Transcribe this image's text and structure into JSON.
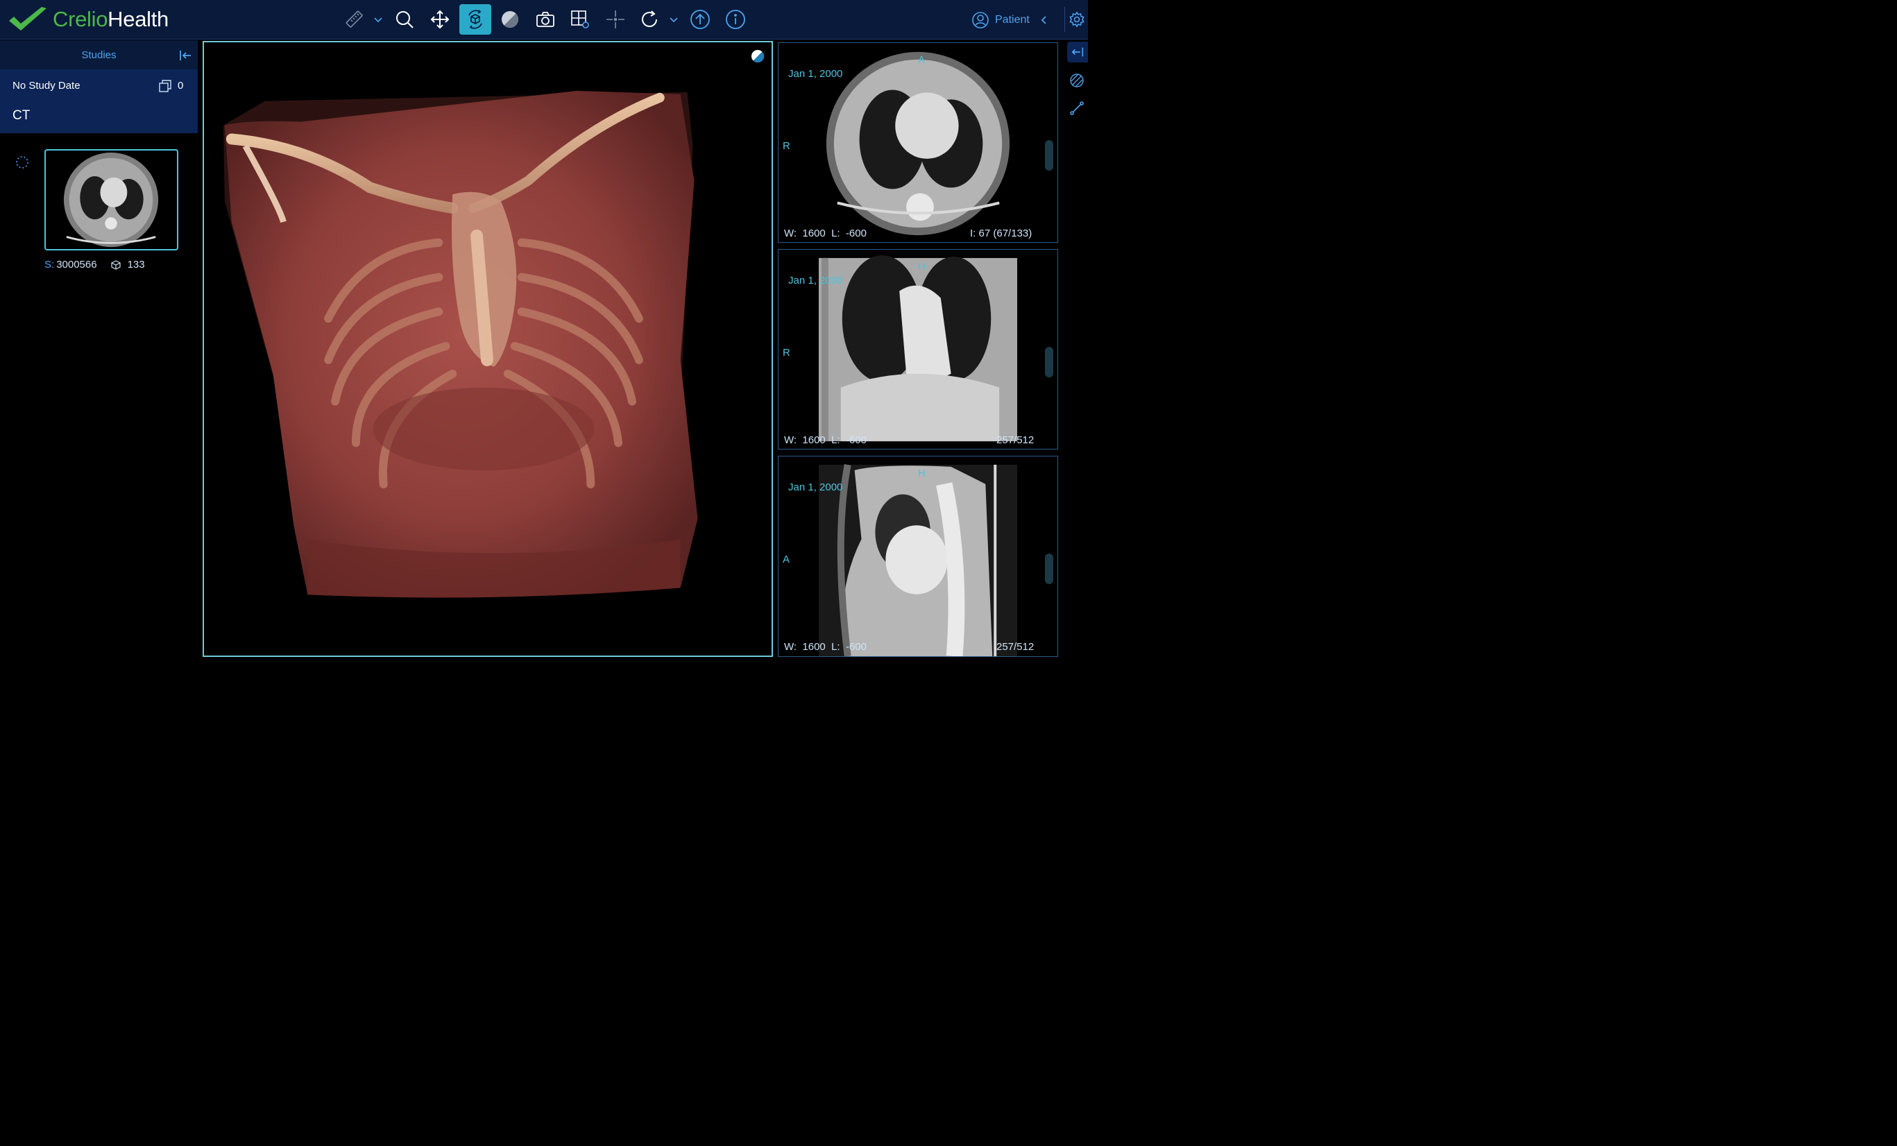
{
  "brand": {
    "part1": "Crelio",
    "part2": "Health",
    "green": "#4cb848"
  },
  "toolbar": {
    "tools": [
      {
        "name": "ruler-icon",
        "active": false
      },
      {
        "name": "zoom-icon",
        "active": false
      },
      {
        "name": "pan-icon",
        "active": false
      },
      {
        "name": "rotate-3d-icon",
        "active": true
      },
      {
        "name": "window-level-icon",
        "active": false
      },
      {
        "name": "camera-icon",
        "active": false
      },
      {
        "name": "layout-settings-icon",
        "active": false
      },
      {
        "name": "crosshair-icon",
        "active": false
      },
      {
        "name": "reset-icon",
        "active": false
      },
      {
        "name": "upload-icon",
        "active": false
      },
      {
        "name": "info-icon",
        "active": false
      }
    ],
    "patient_label": "Patient",
    "accent": "#2aa9c9"
  },
  "sidebar": {
    "title": "Studies",
    "study": {
      "date": "No Study Date",
      "count": "0",
      "modality": "CT"
    },
    "series": {
      "s_label": "S:",
      "number": "3000566",
      "frames": "133"
    }
  },
  "viewports": {
    "axial": {
      "date": "Jan 1, 2000",
      "top": "A",
      "left": "R",
      "wl": "W:  1600  L:  -600",
      "index": "I: 67 (67/133)"
    },
    "coronal": {
      "date": "Jan 1, 2000",
      "top": "H",
      "left": "R",
      "wl": "W:  1600  L:  -600",
      "index": "257/512"
    },
    "sagittal": {
      "date": "Jan 1, 2000",
      "top": "H",
      "left": "A",
      "wl": "W:  1600  L:  -600",
      "index": "257/512"
    }
  }
}
